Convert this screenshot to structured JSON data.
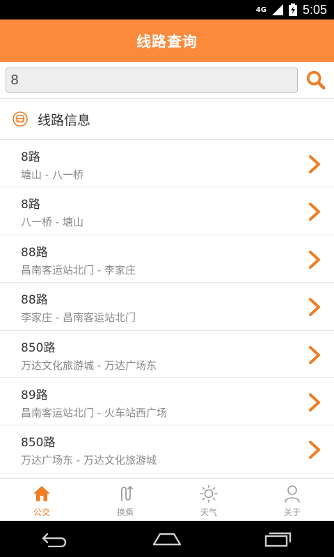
{
  "status_bar": {
    "network": "4G",
    "time": "5:05"
  },
  "app_bar": {
    "title": "线路查询"
  },
  "search": {
    "value": "8",
    "placeholder": ""
  },
  "section": {
    "title": "线路信息"
  },
  "routes": [
    {
      "name": "8路",
      "direction": "塘山 - 八一桥"
    },
    {
      "name": "8路",
      "direction": "八一桥 - 塘山"
    },
    {
      "name": "88路",
      "direction": "昌南客运站北门 - 李家庄"
    },
    {
      "name": "88路",
      "direction": "李家庄 - 昌南客运站北门"
    },
    {
      "name": "850路",
      "direction": "万达文化旅游城 - 万达广场东"
    },
    {
      "name": "89路",
      "direction": "昌南客运站北门 - 火车站西广场"
    },
    {
      "name": "850路",
      "direction": "万达广场东 - 万达文化旅游城"
    }
  ],
  "tabs": [
    {
      "label": "公交",
      "icon": "home-icon",
      "active": true
    },
    {
      "label": "换乘",
      "icon": "transfer-icon",
      "active": false
    },
    {
      "label": "天气",
      "icon": "sun-icon",
      "active": false
    },
    {
      "label": "关于",
      "icon": "person-icon",
      "active": false
    }
  ],
  "colors": {
    "accent": "#fb8a3c",
    "accent_dark": "#f07d22",
    "text": "#333333",
    "subtext": "#888888"
  }
}
